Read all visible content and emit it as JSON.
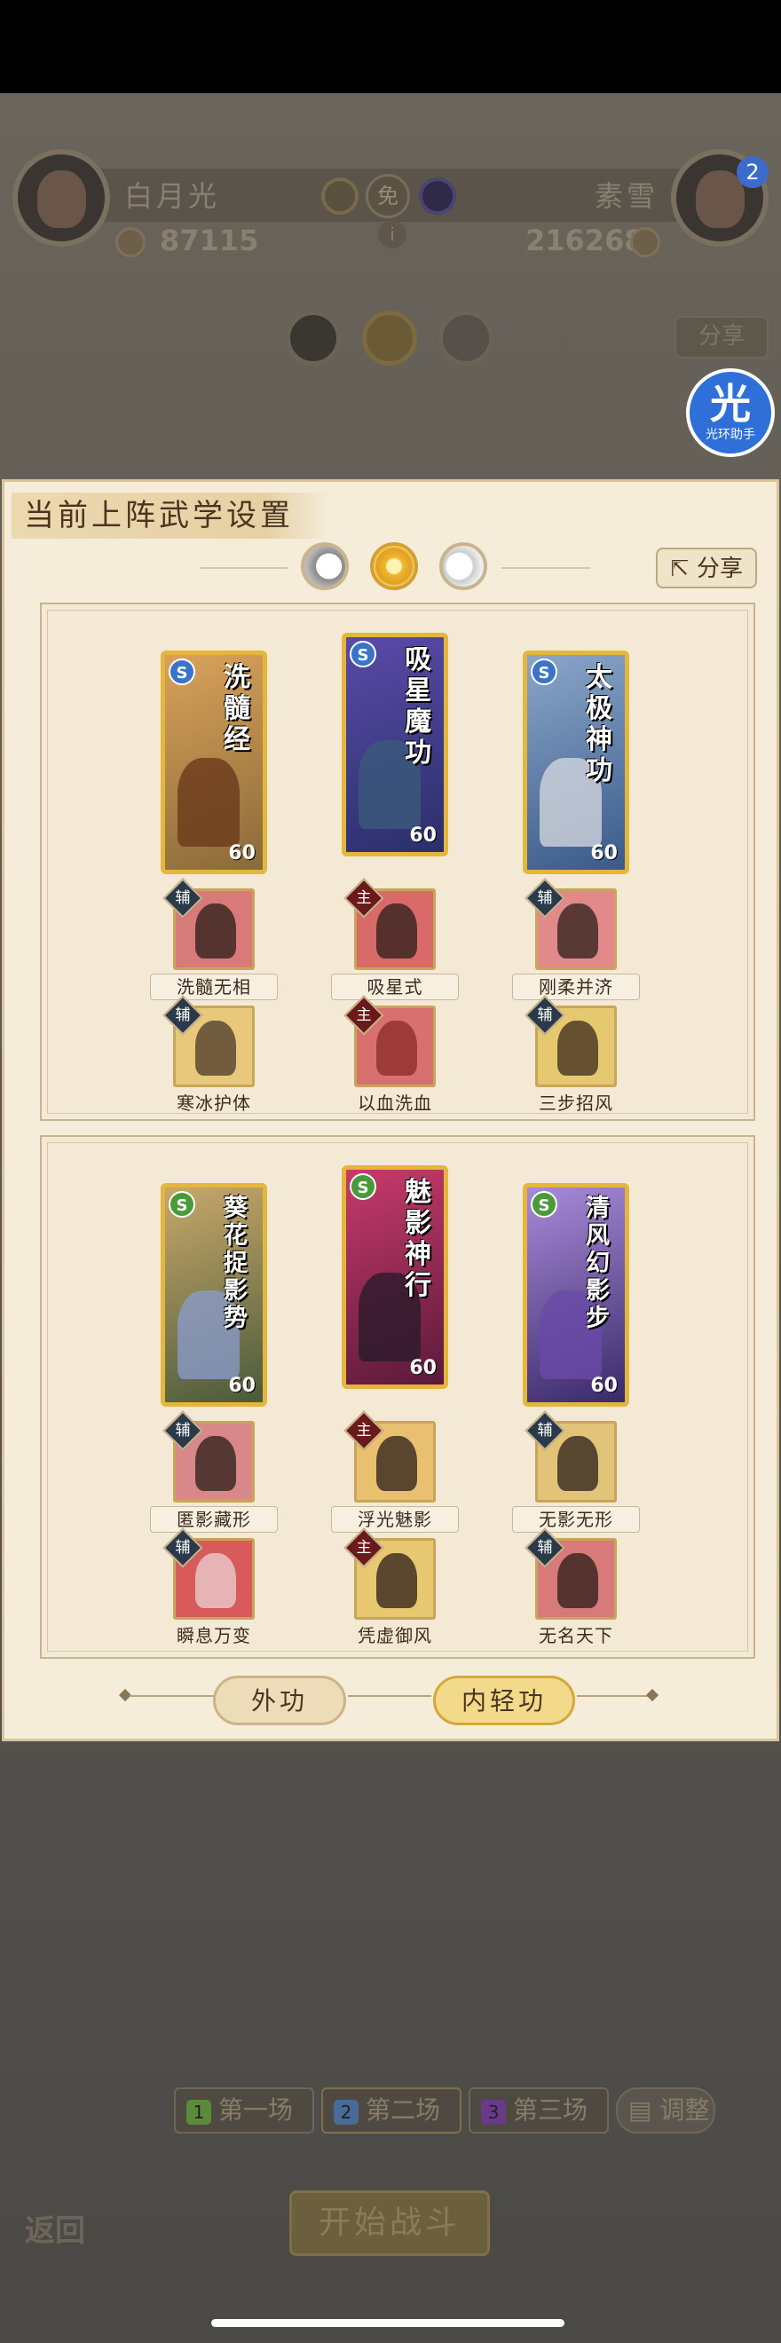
{
  "top_bar": {
    "left_player": {
      "name": "白月光",
      "score": "87115"
    },
    "right_player": {
      "name": "素雪",
      "score": "216268",
      "badge": "2"
    },
    "vs_label": "免",
    "info_icon": "i"
  },
  "background": {
    "share_label": "分享",
    "assist": {
      "big": "光",
      "small": "光环助手"
    }
  },
  "modal": {
    "title": "当前上阵武学设置",
    "share_label": "分享",
    "section1": {
      "cards": [
        {
          "title": "洗髓经",
          "level": "60",
          "type_icon": "S",
          "colors": [
            "#8a6a3a",
            "#d9a25a"
          ]
        },
        {
          "title": "吸星魔功",
          "level": "60",
          "type_icon": "S",
          "colors": [
            "#2a2f6a",
            "#5a4aa8"
          ]
        },
        {
          "title": "太极神功",
          "level": "60",
          "type_icon": "S",
          "colors": [
            "#3a5a8a",
            "#8aa6c8"
          ]
        }
      ],
      "skills_row1": [
        {
          "tag": "辅",
          "label": "洗髓无相",
          "color": "#d87a7a"
        },
        {
          "tag": "主",
          "label": "吸星式",
          "color": "#d86a6a"
        },
        {
          "tag": "辅",
          "label": "刚柔并济",
          "color": "#e28a8a"
        }
      ],
      "skills_row2": [
        {
          "tag": "辅",
          "label": "寒冰护体",
          "color": "#e8c87a"
        },
        {
          "tag": "主",
          "label": "以血洗血",
          "color": "#d87070"
        },
        {
          "tag": "辅",
          "label": "三步招风",
          "color": "#e6c870"
        }
      ]
    },
    "section2": {
      "cards": [
        {
          "title": "葵花捉影势",
          "level": "60",
          "type_icon": "S",
          "colors": [
            "#4a5a3a",
            "#c8a86a"
          ]
        },
        {
          "title": "魅影神行",
          "level": "60",
          "type_icon": "S",
          "colors": [
            "#5a1a3a",
            "#c83a6a"
          ]
        },
        {
          "title": "清风幻影步",
          "level": "60",
          "type_icon": "S",
          "colors": [
            "#3a2a6a",
            "#a88ad8"
          ]
        }
      ],
      "skills_row1": [
        {
          "tag": "辅",
          "label": "匿影藏形",
          "color": "#d88888"
        },
        {
          "tag": "主",
          "label": "浮光魅影",
          "color": "#e8c070"
        },
        {
          "tag": "辅",
          "label": "无影无形",
          "color": "#e2c478"
        }
      ],
      "skills_row2": [
        {
          "tag": "辅",
          "label": "瞬息万变",
          "color": "#d85a5a"
        },
        {
          "tag": "主",
          "label": "凭虚御风",
          "color": "#e8c870"
        },
        {
          "tag": "辅",
          "label": "无名天下",
          "color": "#d87a7a"
        }
      ]
    },
    "tabs": {
      "outer": "外功",
      "inner": "内轻功"
    }
  },
  "footer": {
    "rounds": [
      {
        "num": "1",
        "label": "第一场",
        "color": "#6aa04a"
      },
      {
        "num": "2",
        "label": "第二场",
        "color": "#4a7ab8"
      },
      {
        "num": "3",
        "label": "第三场",
        "color": "#8a4ab0"
      }
    ],
    "adjust": "调整",
    "start": "开始战斗",
    "back": "返回"
  }
}
